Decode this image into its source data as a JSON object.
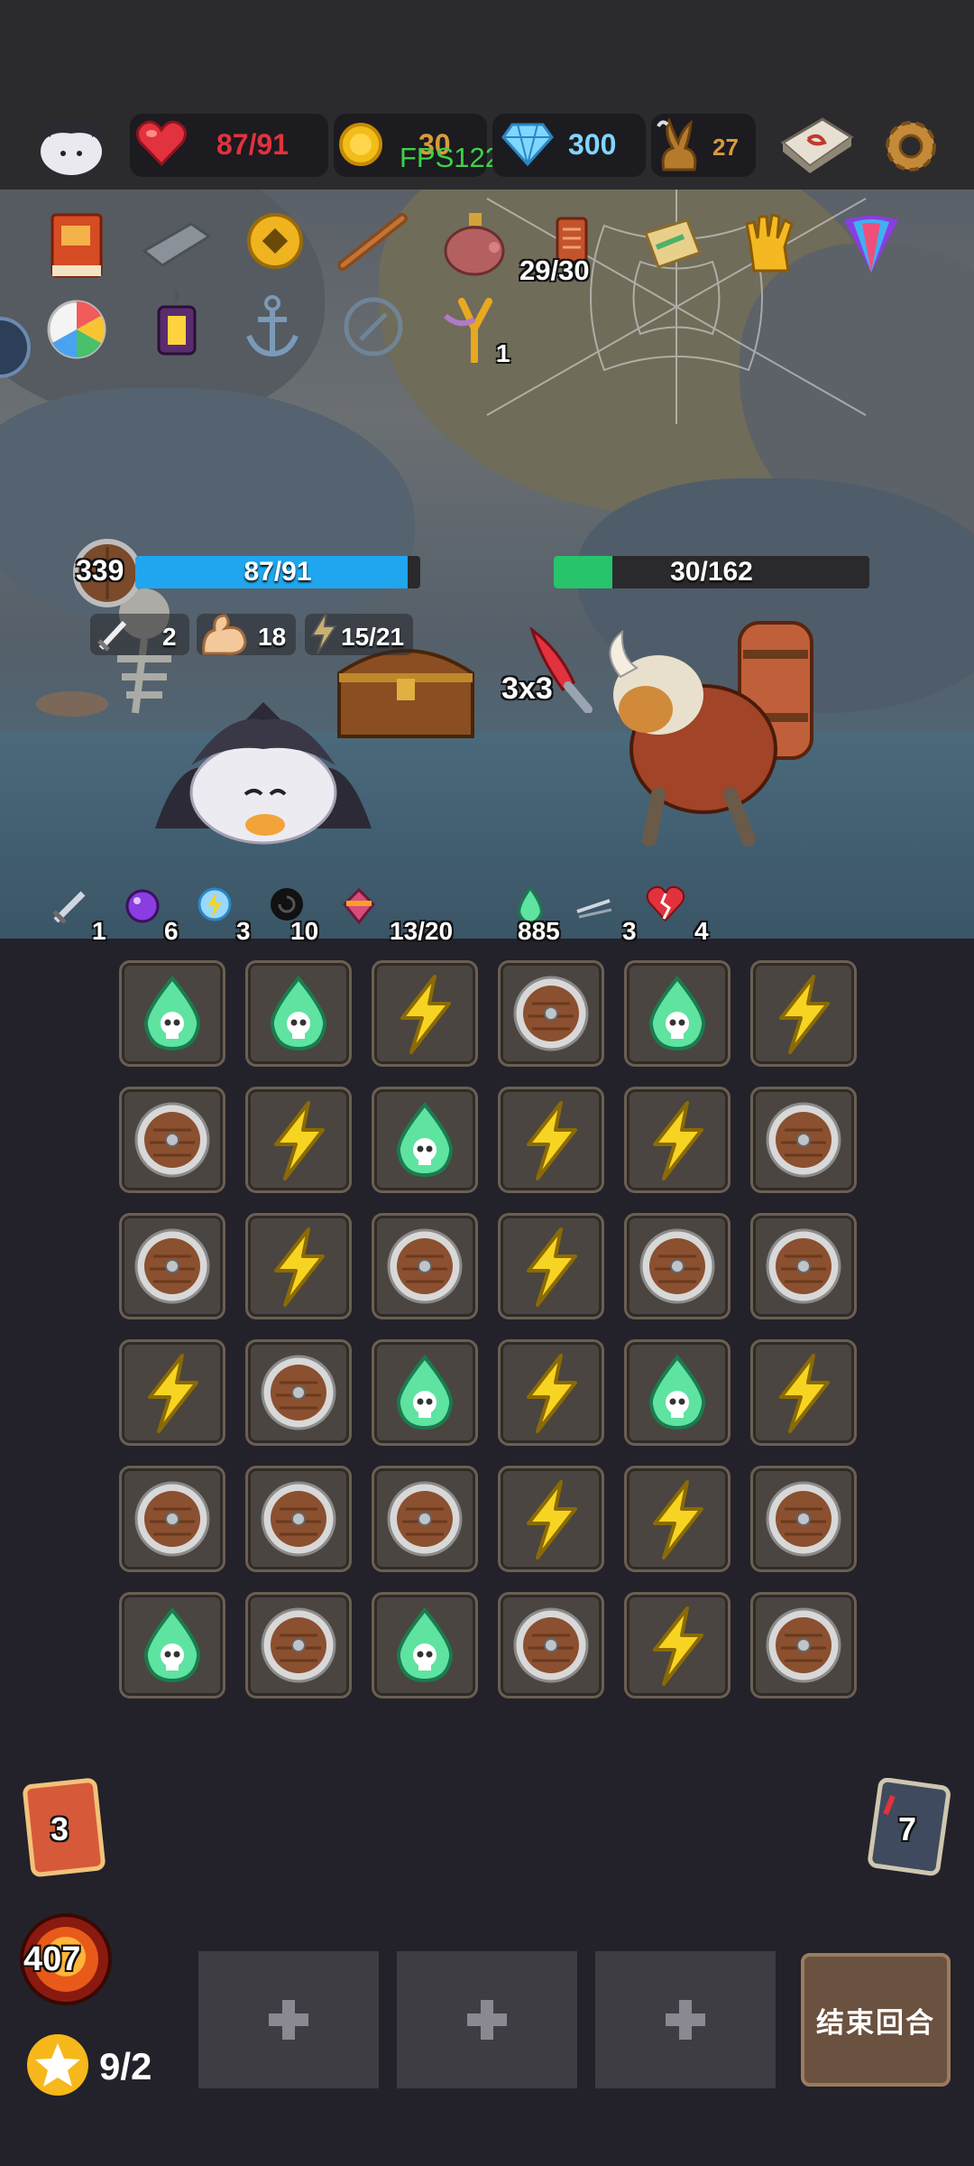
{
  "hud": {
    "health": "87/91",
    "gold": "30",
    "fps": "FPS122",
    "gems": "300",
    "antlers": "27"
  },
  "relics": {
    "ticket_count": "29/30",
    "slingshot_count": "1"
  },
  "player": {
    "shield": "339",
    "hp": "87/91",
    "hp_fraction": 0.956,
    "attack": "2",
    "strength": "18",
    "energy": "15/21"
  },
  "enemy": {
    "hp": "30/162",
    "hp_fraction": 0.185,
    "intent": "3x3"
  },
  "status_effects": [
    {
      "icon": "sword-icon",
      "value": "1"
    },
    {
      "icon": "purple-orb-icon",
      "value": "6"
    },
    {
      "icon": "lightning-orb-icon",
      "value": "3"
    },
    {
      "icon": "spiral-head-icon",
      "value": "10"
    },
    {
      "icon": "spinning-top-icon",
      "value": "13/20"
    },
    {
      "icon": "poison-drop-icon",
      "value": "885"
    },
    {
      "icon": "daggers-icon",
      "value": "3"
    },
    {
      "icon": "broken-heart-icon",
      "value": "4"
    }
  ],
  "board": [
    [
      "poison",
      "poison",
      "lightning",
      "shield",
      "poison",
      "lightning"
    ],
    [
      "shield",
      "lightning",
      "poison",
      "lightning",
      "lightning",
      "shield"
    ],
    [
      "shield",
      "lightning",
      "shield",
      "lightning",
      "shield",
      "shield"
    ],
    [
      "lightning",
      "shield",
      "poison",
      "lightning",
      "poison",
      "lightning"
    ],
    [
      "shield",
      "shield",
      "shield",
      "lightning",
      "lightning",
      "shield"
    ],
    [
      "poison",
      "shield",
      "poison",
      "shield",
      "lightning",
      "shield"
    ]
  ],
  "footer": {
    "draw_pile": "3",
    "discard_pile": "7",
    "fire_orb": "407",
    "stars": "9/2",
    "end_turn": "结束回合"
  },
  "colors": {
    "hp_red": "#e2323d",
    "gem_blue": "#7fd6ff",
    "antler_gold": "#d89b3a",
    "fps_green": "#3fd14a",
    "player_bar": "#1fa6ee",
    "enemy_bar": "#27c46c",
    "poison_green": "#5fe3a1",
    "lightning_yellow": "#f7d421"
  }
}
